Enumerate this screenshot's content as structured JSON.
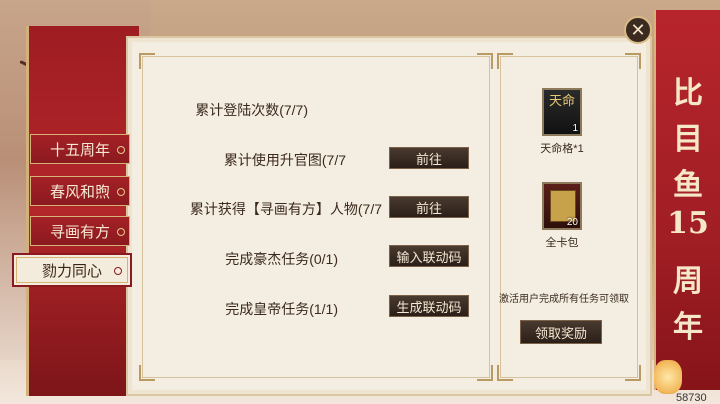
{
  "tabs": [
    {
      "label": "十五周年",
      "active": false
    },
    {
      "label": "春风和煦",
      "active": false
    },
    {
      "label": "寻画有方",
      "active": false
    },
    {
      "label": "勠力同心",
      "active": true
    }
  ],
  "tasks": [
    {
      "label": "累计登陆次数(7/7)",
      "button": ""
    },
    {
      "label": "累计使用升官图(7/7",
      "button": "前往"
    },
    {
      "label": "累计获得【寻画有方】人物(7/7",
      "button": "前往"
    },
    {
      "label": "完成豪杰任务(0/1)",
      "button": "输入联动码"
    },
    {
      "label": "完成皇帝任务(1/1)",
      "button": "生成联动码"
    }
  ],
  "rewards": [
    {
      "label": "天命格*1",
      "icon_text": "天命",
      "qty": "1"
    },
    {
      "label": "全卡包",
      "icon_text": "",
      "qty": "20"
    }
  ],
  "reward_note": "激活用户完成所有任务可领取",
  "claim_button": "领取奖励",
  "banner": {
    "chars": [
      "比",
      "目",
      "鱼",
      "15",
      "周",
      "年"
    ]
  },
  "close_icon": "close-icon",
  "footer_number": "58730"
}
